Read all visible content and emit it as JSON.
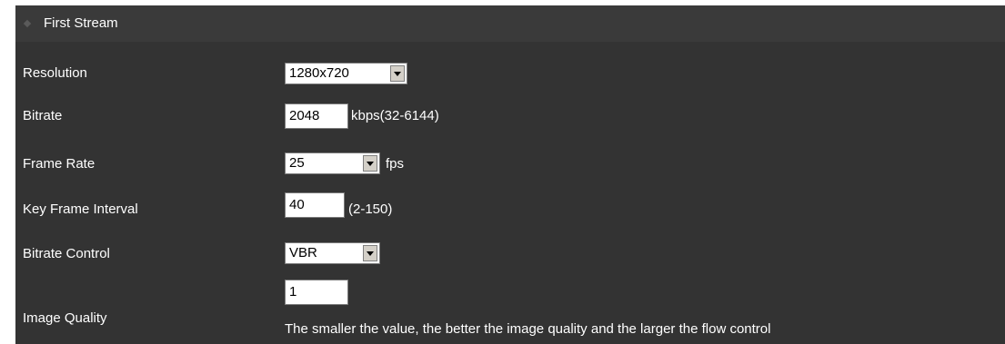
{
  "section": {
    "title": "First Stream"
  },
  "fields": {
    "resolution": {
      "label": "Resolution",
      "value": "1280x720"
    },
    "bitrate": {
      "label": "Bitrate",
      "value": "2048",
      "unit": "kbps(32-6144)"
    },
    "frame_rate": {
      "label": "Frame Rate",
      "value": "25",
      "unit": "fps"
    },
    "key_frame_interval": {
      "label": "Key Frame Interval",
      "value": "40",
      "range": "(2-150)"
    },
    "bitrate_control": {
      "label": "Bitrate Control",
      "value": "VBR"
    },
    "image_quality": {
      "label": "Image Quality",
      "value": "1",
      "note": "The smaller the value, the better the image quality and the larger the flow control"
    }
  }
}
